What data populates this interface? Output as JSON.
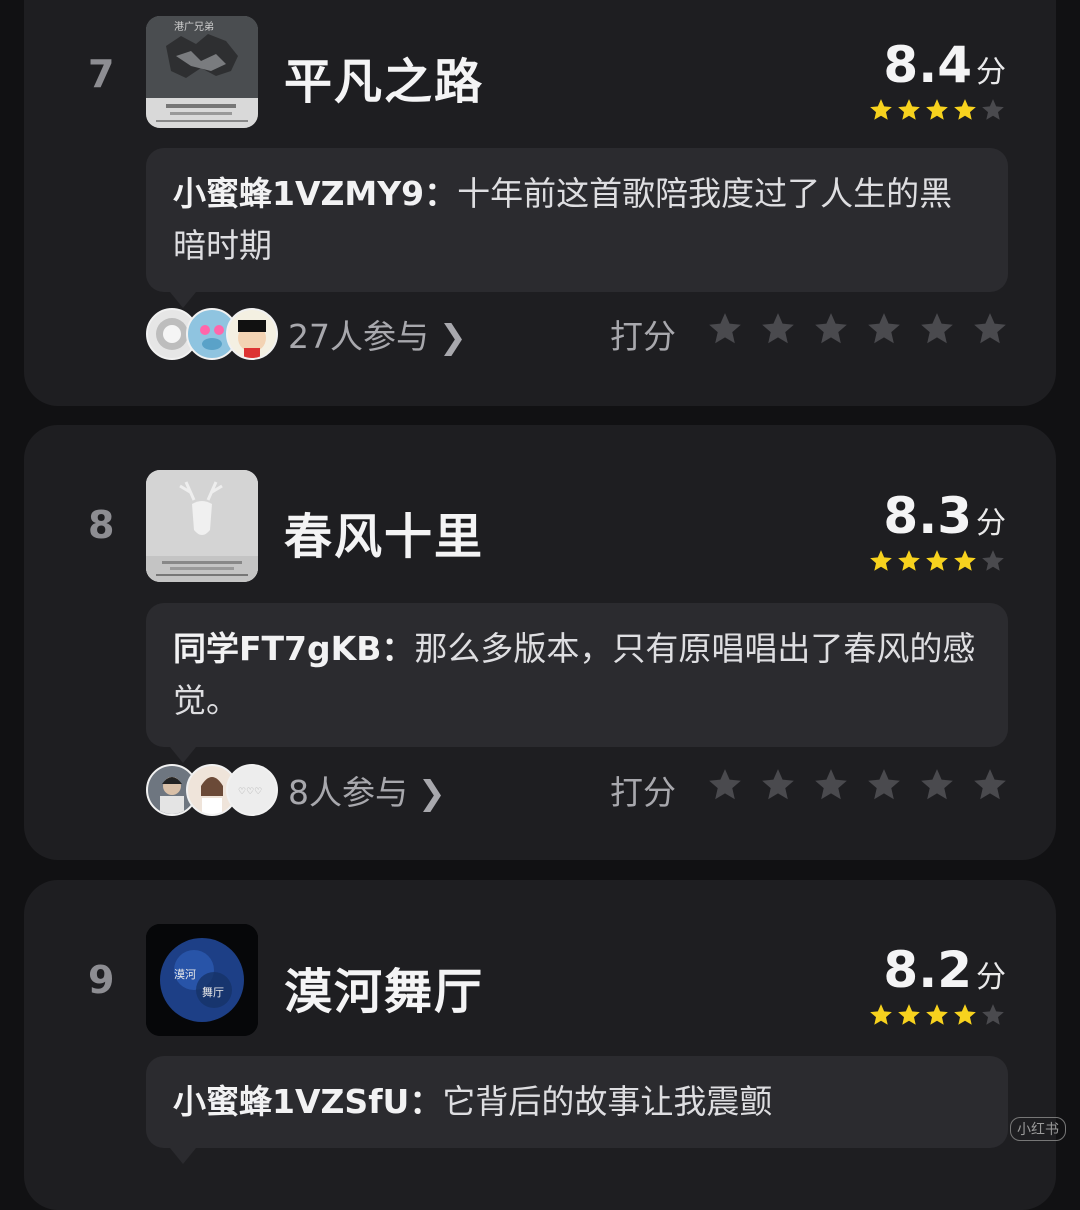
{
  "songs": [
    {
      "rank": "7",
      "title": "平凡之路",
      "score": "8.4",
      "score_unit": "分",
      "filled_stars": 4,
      "comment_user": "小蜜蜂1VZMY9：",
      "comment_text": "十年前这首歌陪我度过了人生的黑暗时期",
      "participants": "27人参与",
      "rate_label": "打分"
    },
    {
      "rank": "8",
      "title": "春风十里",
      "score": "8.3",
      "score_unit": "分",
      "filled_stars": 4,
      "comment_user": "同学FT7gKB：",
      "comment_text": "那么多版本，只有原唱唱出了春风的感觉。",
      "participants": "8人参与",
      "rate_label": "打分"
    },
    {
      "rank": "9",
      "title": "漠河舞厅",
      "score": "8.2",
      "score_unit": "分",
      "filled_stars": 4,
      "comment_user": "小蜜蜂1VZSfU：",
      "comment_text": "它背后的故事让我震颤"
    }
  ],
  "cover_text": {
    "song0_top": "港广兄弟",
    "song2_a": "漠河",
    "song2_b": "舞厅"
  },
  "icons": {
    "star_filled": "star-icon",
    "star_empty": "star-outline-icon",
    "chevron": "chevron-right-icon"
  },
  "colors": {
    "background": "#111113",
    "card": "#1e1e21",
    "bubble": "#2b2b2f",
    "star_gold": "#f7d21e",
    "star_empty": "#4a4a4e"
  },
  "watermark": "小红书"
}
